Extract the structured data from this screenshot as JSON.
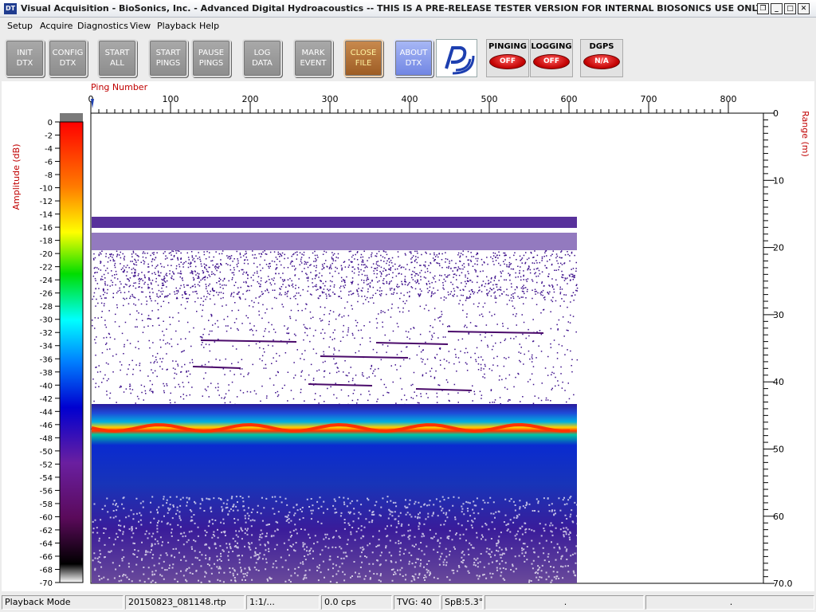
{
  "titlebar": {
    "icon_text": "DT",
    "title": "Visual Acquisition  -  BioSonics, Inc.  -  Advanced Digital Hydroacoustics  -- THIS IS A PRE-RELEASE TESTER VERSION FOR INTERNAL BIOSONICS USE ONLY"
  },
  "menu": [
    "Setup",
    "Acquire",
    "Diagnostics",
    "View",
    "Playback",
    "Help"
  ],
  "toolbar": {
    "init": [
      "INIT",
      "DTX"
    ],
    "config": [
      "CONFIG",
      "DTX"
    ],
    "start_all": [
      "START",
      "ALL"
    ],
    "start_pings": [
      "START",
      "PINGS"
    ],
    "pause_pings": [
      "PAUSE",
      "PINGS"
    ],
    "log_data": [
      "LOG",
      "DATA"
    ],
    "mark_event": [
      "MARK",
      "EVENT"
    ],
    "close_file": [
      "CLOSE",
      "FILE"
    ],
    "about_dtx": [
      "ABOUT",
      "DTX"
    ]
  },
  "indicators": {
    "pinging": {
      "label": "PINGING",
      "state": "OFF"
    },
    "logging": {
      "label": "LOGGING",
      "state": "OFF"
    },
    "dgps": {
      "label": "DGPS",
      "state": "N/A"
    }
  },
  "echogram": {
    "ping_axis_label": "Ping Number",
    "ping_ticks": [
      "0",
      "100",
      "200",
      "300",
      "400",
      "500",
      "600",
      "700",
      "800"
    ],
    "range_axis_label": "Range (m)",
    "range_ticks": [
      "0",
      "10",
      "20",
      "30",
      "40",
      "50",
      "60",
      "70.0"
    ],
    "amplitude_label": "Amplitude (dB)",
    "amplitude_ticks": [
      "0",
      "-2",
      "-4",
      "-6",
      "-8",
      "-10",
      "-12",
      "-14",
      "-16",
      "-18",
      "-20",
      "-22",
      "-24",
      "-26",
      "-28",
      "-30",
      "-32",
      "-34",
      "-36",
      "-38",
      "-40",
      "-42",
      "-44",
      "-46",
      "-48",
      "-50",
      "-52",
      "-54",
      "-56",
      "-58",
      "-60",
      "-62",
      "-64",
      "-66",
      "-68",
      "-70"
    ],
    "colors": {
      "axis_label": "#c00000",
      "bottom_echo": "#ff3300",
      "noise": "#3b0d8a"
    }
  },
  "statusbar": {
    "mode": "Playback Mode",
    "file": "20150823_081148.rtp",
    "ratio": "1:1/...",
    "rate": "0.0 cps",
    "tvg": "TVG: 40",
    "spb": "SpB:5.3°",
    "extra1": ".",
    "extra2": "."
  }
}
